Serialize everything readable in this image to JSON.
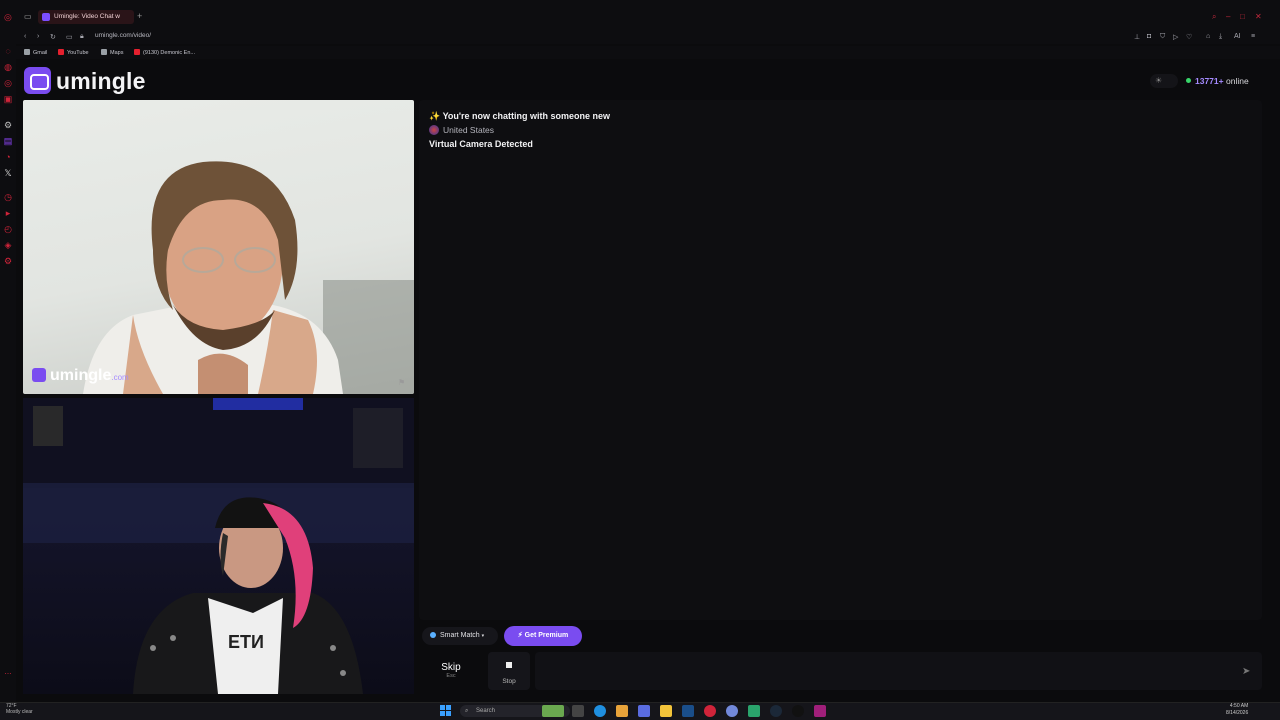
{
  "browser": {
    "tab_title": "Umingle: Video Chat w",
    "url": "umingle.com/video/",
    "bookmarks": [
      {
        "label": "Gmail",
        "color": "#9aa0a6"
      },
      {
        "label": "YouTube",
        "color": "#e5202e"
      },
      {
        "label": "Maps",
        "color": "#9aa0a6"
      },
      {
        "label": "(9130) Demonic En...",
        "color": "#e5202e"
      }
    ]
  },
  "site": {
    "logo_text": "umingle",
    "online_count": "13771+",
    "online_label": "online",
    "watermark_text": "umingle",
    "watermark_suffix": ".com"
  },
  "chat": {
    "status_icon": "✨",
    "status_message": "You're now chatting with someone new",
    "country": "United States",
    "notice": "Virtual Camera Detected"
  },
  "controls": {
    "smart_match_label": "Smart Match",
    "premium_label": "Get Premium",
    "skip_label": "Skip",
    "skip_hint": "Esc",
    "stop_label": "Stop",
    "message_placeholder": ""
  },
  "taskbar": {
    "weather_temp": "72°F",
    "weather_desc": "Mostly clear",
    "search_placeholder": "Search",
    "time": "4:50 AM",
    "date": "8/14/2026"
  },
  "colors": {
    "accent": "#7a4cf0",
    "online_dot": "#38d66a",
    "browser_accent": "#d0243a"
  }
}
